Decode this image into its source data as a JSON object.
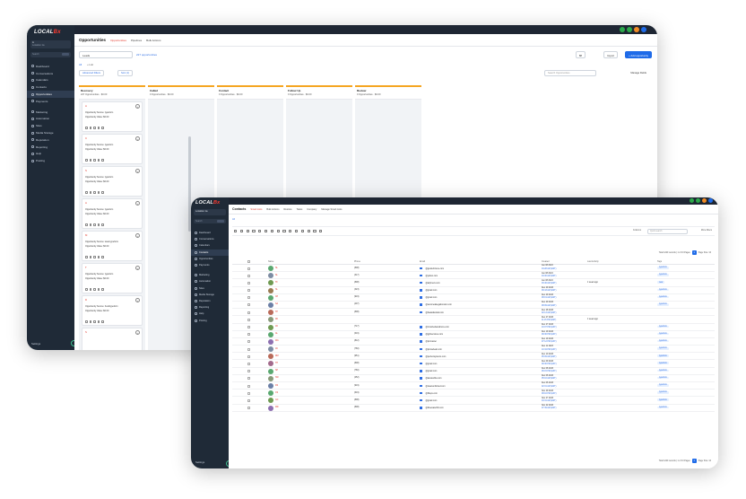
{
  "opportunities_window": {
    "logo_text": "LOCAL",
    "logo_accent": "Bx",
    "account": {
      "name": "A",
      "location": "Location 1a"
    },
    "sidebar_search": "Search",
    "nav": [
      {
        "label": "Dashboard"
      },
      {
        "label": "Conversations"
      },
      {
        "label": "Calendars"
      },
      {
        "label": "Contacts"
      },
      {
        "label": "Opportunities",
        "active": true
      },
      {
        "label": "Payments"
      },
      {
        "label": "Marketing"
      },
      {
        "label": "Automation"
      },
      {
        "label": "Sites"
      },
      {
        "label": "Media Storage"
      },
      {
        "label": "Reputation"
      },
      {
        "label": "Reporting"
      },
      {
        "label": "Help"
      },
      {
        "label": "Posting"
      }
    ],
    "settings_label": "Settings",
    "header": {
      "title": "Opportunities",
      "tabs": [
        "Opportunities",
        "Pipelines",
        "Bulk Actions"
      ]
    },
    "pipeline_select": "Leads",
    "opportunity_count": "227 opportunities",
    "toolbar": {
      "view_label": "88",
      "import_label": "Import",
      "add_label": "+ Add opportunity"
    },
    "view_tabs": [
      "All",
      "+ List"
    ],
    "filters": {
      "advanced": "Advanced Filters",
      "sort": "Sort (1)"
    },
    "search_placeholder": "Search Opportunities",
    "manage_fields": "Manage Fields",
    "columns": [
      {
        "name": "Recovery",
        "meta": "227 Opportunities · $0.00"
      },
      {
        "name": "Called",
        "meta": "0 Opportunities · $0.00"
      },
      {
        "name": "Contact",
        "meta": "0 Opportunities · $0.00"
      },
      {
        "name": "Follow Up",
        "meta": "0 Opportunities · $0.00"
      },
      {
        "name": "Review",
        "meta": "0 Opportunities · $0.00"
      }
    ],
    "cards": [
      {
        "name": "A",
        "source": "Opportunity Source:  typeform",
        "value": "Opportunity Value:   $0.00"
      },
      {
        "name": "C",
        "source": "Opportunity Source:  typeform",
        "value": "Opportunity Value:   $0.00"
      },
      {
        "name": "S",
        "source": "Opportunity Source:  typeform",
        "value": "Opportunity Value:   $0.00"
      },
      {
        "name": "A",
        "source": "Opportunity Source:  typeform",
        "value": "Opportunity Value:   $0.00"
      },
      {
        "name": "M",
        "source": "Opportunity Source:  www.typeform",
        "value": "Opportunity Value:   $0.00"
      },
      {
        "name": "T",
        "source": "Opportunity Source:  typeform",
        "value": "Opportunity Value:   $0.00"
      },
      {
        "name": "D",
        "source": "Opportunity Source:  hoodtypeform",
        "value": "Opportunity Value:   $0.00"
      },
      {
        "name": "S",
        "source": "",
        "value": ""
      }
    ],
    "dot_colors": [
      "#2ba84a",
      "#2ba84a",
      "#f08a24",
      "#1f6be8"
    ]
  },
  "contacts_window": {
    "logo_text": "LOCAL",
    "logo_accent": "Bx",
    "account_location": "Location 1a",
    "sidebar_search": "Search",
    "nav": [
      {
        "label": "Dashboard"
      },
      {
        "label": "Conversations"
      },
      {
        "label": "Calendars"
      },
      {
        "label": "Contacts",
        "active": true
      },
      {
        "label": "Opportunities"
      },
      {
        "label": "Payments"
      },
      {
        "label": "Marketing"
      },
      {
        "label": "Automation"
      },
      {
        "label": "Sites"
      },
      {
        "label": "Media Storage"
      },
      {
        "label": "Reputation"
      },
      {
        "label": "Reporting"
      },
      {
        "label": "Help"
      },
      {
        "label": "Posting"
      }
    ],
    "settings_label": "Settings",
    "header": {
      "title": "Contacts",
      "tabs": [
        "Smart Lists",
        "Bulk Actions",
        "Restore",
        "Tasks",
        "Company",
        "Manage Smart Lists"
      ]
    },
    "list_tab": "All",
    "columns_label": "Columns",
    "search_placeholder": "Quick search",
    "more_filters": "More Filters",
    "pager_text": "Total 1220 records | 1 of 13 Pages",
    "page_number": "1",
    "page_size": "Page Size: 10",
    "table_headers": [
      "Name",
      "Phone",
      "Email",
      "Created",
      "Last Activity",
      "Tags"
    ],
    "contacts": [
      {
        "initials": "SL",
        "color": "#5aa870",
        "phone": "(808)",
        "email": "@gsuiteforsure.com",
        "created": "Jan 08 2024",
        "time": "04:28 AM (EST)",
        "activity": "",
        "tag": "typeform"
      },
      {
        "initials": "SL",
        "color": "#7d8ca3",
        "phone": "(317)",
        "email": "@yahoo.com",
        "created": "Jan 08 2024",
        "time": "04:30 AM (EST)",
        "activity": "",
        "tag": "typeform"
      },
      {
        "initials": "TF",
        "color": "#6f9a52",
        "phone": "(808)",
        "email": "@airpiners.com",
        "created": "Jan 08 2024",
        "time": "03:46 AM (EST)",
        "activity": "1 week ago",
        "tag": "new"
      },
      {
        "initials": "SL",
        "color": "#9a7b52",
        "phone": "(323)",
        "email": "@gmail.com",
        "created": "Dec 29 2023",
        "time": "09:43 AM (EST)",
        "activity": "",
        "tag": "typeform"
      },
      {
        "initials": "CP",
        "color": "#5aa870",
        "phone": "(919)",
        "email": "@gmail.com",
        "created": "Dec 29 2023",
        "time": "08:19 AM (EST)",
        "activity": "",
        "tag": "typeform"
      },
      {
        "initials": "SA",
        "color": "#6b7fa6",
        "phone": "(407)",
        "email": "@servicedelegationsinc.com",
        "created": "Dec 29 2023",
        "time": "08:09 AM (EST)",
        "activity": "",
        "tag": "typeform"
      },
      {
        "initials": "TP",
        "color": "#b96a5a",
        "phone": "(808)",
        "email": "@hawaiikoolair.com",
        "created": "Dec 28 2023",
        "time": "02:13 AM (EST)",
        "activity": "",
        "tag": ""
      },
      {
        "initials": "DK",
        "color": "#8a9a7a",
        "phone": "",
        "email": "",
        "created": "Dec 27 2023",
        "time": "11:15 PM (EST)",
        "activity": "1 week ago",
        "tag": ""
      },
      {
        "initials": "JR",
        "color": "#6f9a52",
        "phone": "(717)",
        "email": "@rmsshedsandmore.com",
        "created": "Dec 27 2023",
        "time": "10:07 PM (EST)",
        "activity": "",
        "tag": "typeform"
      },
      {
        "initials": "AL",
        "color": "#5aa870",
        "phone": "(619)",
        "email": "@gphservices.com",
        "created": "Dec 19 2023",
        "time": "09:30 PM (EST)",
        "activity": "",
        "tag": "typeform"
      },
      {
        "initials": "WA",
        "color": "#8d6fb0",
        "phone": "(812)",
        "email": "@pinmaster",
        "created": "Dec 19 2023",
        "time": "07:12 PM (EST)",
        "activity": "",
        "tag": "typeform"
      },
      {
        "initials": "JD",
        "color": "#7d8ca3",
        "phone": "(760)",
        "email": "@pinnacleair.com",
        "created": "Dec 11 2023",
        "time": "10:34 PM (EST)",
        "activity": "",
        "tag": "typeform"
      },
      {
        "initials": "RM",
        "color": "#b96a5a",
        "phone": "(951)",
        "email": "@perfectsystems.com",
        "created": "Dec 10 2023",
        "time": "05:09 AM (EST)",
        "activity": "",
        "tag": "typeform"
      },
      {
        "initials": "TH",
        "color": "#a36a8c",
        "phone": "(808)",
        "email": "@gmail.com",
        "created": "Dec 09 2023",
        "time": "09:30 PM (EST)",
        "activity": "",
        "tag": "typeform"
      },
      {
        "initials": "SP",
        "color": "#5aa870",
        "phone": "(760)",
        "email": "@gmail.com",
        "created": "Dec 08 2023",
        "time": "06:15 PM (EST)",
        "activity": "",
        "tag": "typeform"
      },
      {
        "initials": "SW",
        "color": "#8a9a7a",
        "phone": "(252)",
        "email": "@alexandria.com",
        "created": "Dec 06 2023",
        "time": "05:16 AM (EST)",
        "activity": "",
        "tag": "typeform"
      },
      {
        "initials": "DS",
        "color": "#6b7fa6",
        "phone": "(919)",
        "email": "@cleanunlimited.com",
        "created": "Dec 06 2023",
        "time": "02:01 AM (EST)",
        "activity": "",
        "tag": "typeform"
      },
      {
        "initials": "CS",
        "color": "#5aa870",
        "phone": "(619)",
        "email": "@hlleps.com",
        "created": "Nov 29 2023",
        "time": "08:16 PM (EST)",
        "activity": "",
        "tag": "typeform"
      },
      {
        "initials": "GC",
        "color": "#6f9a52",
        "phone": "(808)",
        "email": "@gmail.com",
        "created": "Nov 27 2023",
        "time": "04:31 AM (EST)",
        "activity": "",
        "tag": "typeform"
      },
      {
        "initials": "MD",
        "color": "#8d6fb0",
        "phone": "(808)",
        "email": "@bluewaterhiit.com",
        "created": "Nov 22 2023",
        "time": "07:39 AM (EST)",
        "activity": "",
        "tag": "typeform"
      }
    ],
    "dot_colors": [
      "#2ba84a",
      "#2ba84a",
      "#f08a24",
      "#1f6be8"
    ]
  }
}
